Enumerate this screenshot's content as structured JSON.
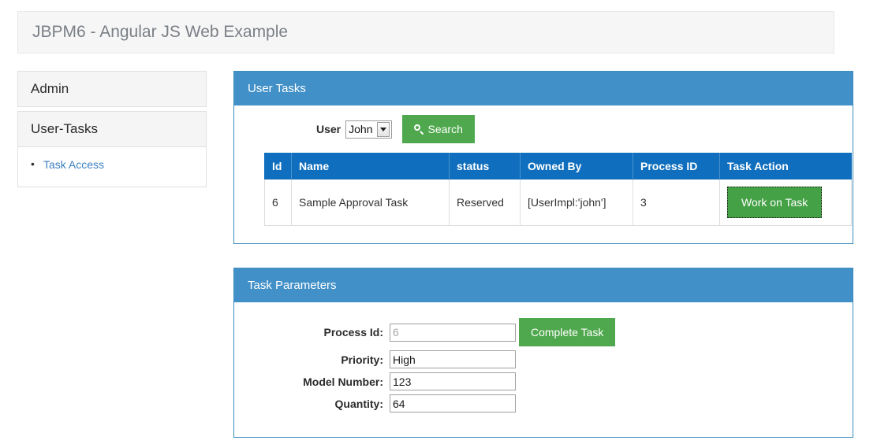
{
  "header": {
    "title": "JBPM6 - Angular JS Web Example"
  },
  "sidebar": {
    "panels": [
      {
        "title": "Admin",
        "items": []
      },
      {
        "title": "User-Tasks",
        "items": [
          {
            "label": "Task Access"
          }
        ]
      }
    ]
  },
  "user_tasks": {
    "panel_title": "User Tasks",
    "search": {
      "user_label": "User",
      "selected_user": "John",
      "user_options": [
        "John"
      ],
      "search_button": "Search",
      "search_icon": "search-icon"
    },
    "table": {
      "columns": [
        "Id",
        "Name",
        "status",
        "Owned By",
        "Process ID",
        "Task Action"
      ],
      "rows": [
        {
          "id": "6",
          "name": "Sample Approval Task",
          "status": "Reserved",
          "owned_by": "[UserImpl:'john']",
          "process_id": "3",
          "action_label": "Work on Task"
        }
      ]
    }
  },
  "task_parameters": {
    "panel_title": "Task Parameters",
    "fields": [
      {
        "label": "Process Id:",
        "value": "6",
        "readonly": true
      },
      {
        "label": "Priority:",
        "value": "High",
        "readonly": false
      },
      {
        "label": "Model Number:",
        "value": "123",
        "readonly": false
      },
      {
        "label": "Quantity:",
        "value": "64",
        "readonly": false
      }
    ],
    "complete_button": "Complete Task"
  },
  "colors": {
    "panel_header_blue": "#4290c8",
    "panel_border_blue": "#3c8dbc",
    "table_header_blue": "#0f6ebd",
    "button_green": "#4fa84d",
    "work_button_green": "#45a146",
    "link_blue": "#3a7fc1",
    "jumbotron_gray": "#f6f6f6"
  }
}
